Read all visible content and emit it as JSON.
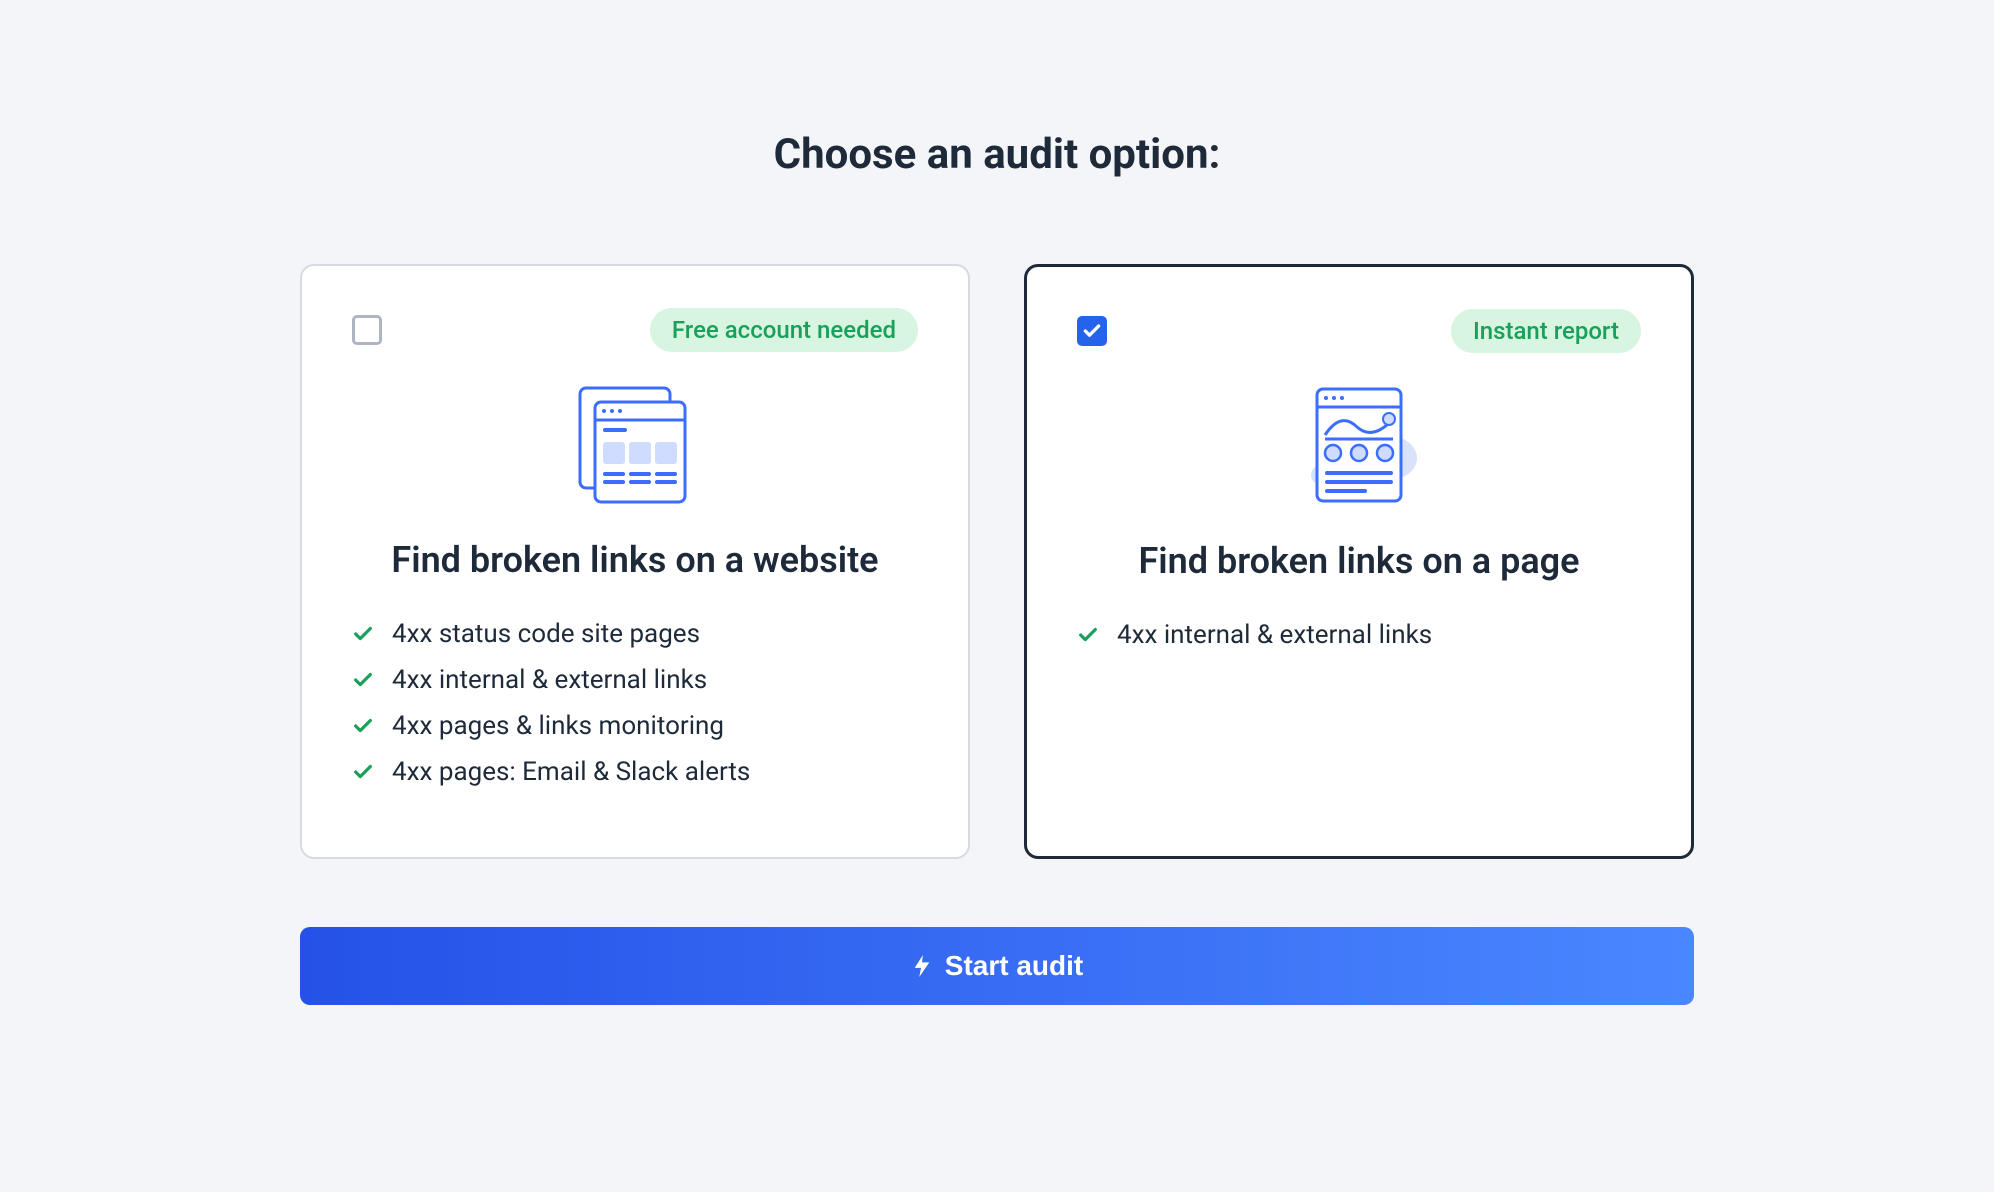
{
  "title": "Choose an audit option:",
  "cards": [
    {
      "selected": false,
      "badge": "Free account needed",
      "title": "Find broken links on a website",
      "features": [
        "4xx status code site pages",
        "4xx internal & external links",
        "4xx pages & links monitoring",
        "4xx pages: Email & Slack alerts"
      ]
    },
    {
      "selected": true,
      "badge": "Instant report",
      "title": "Find broken links on a page",
      "features": [
        "4xx internal & external links"
      ]
    }
  ],
  "button": {
    "label": "Start audit"
  }
}
